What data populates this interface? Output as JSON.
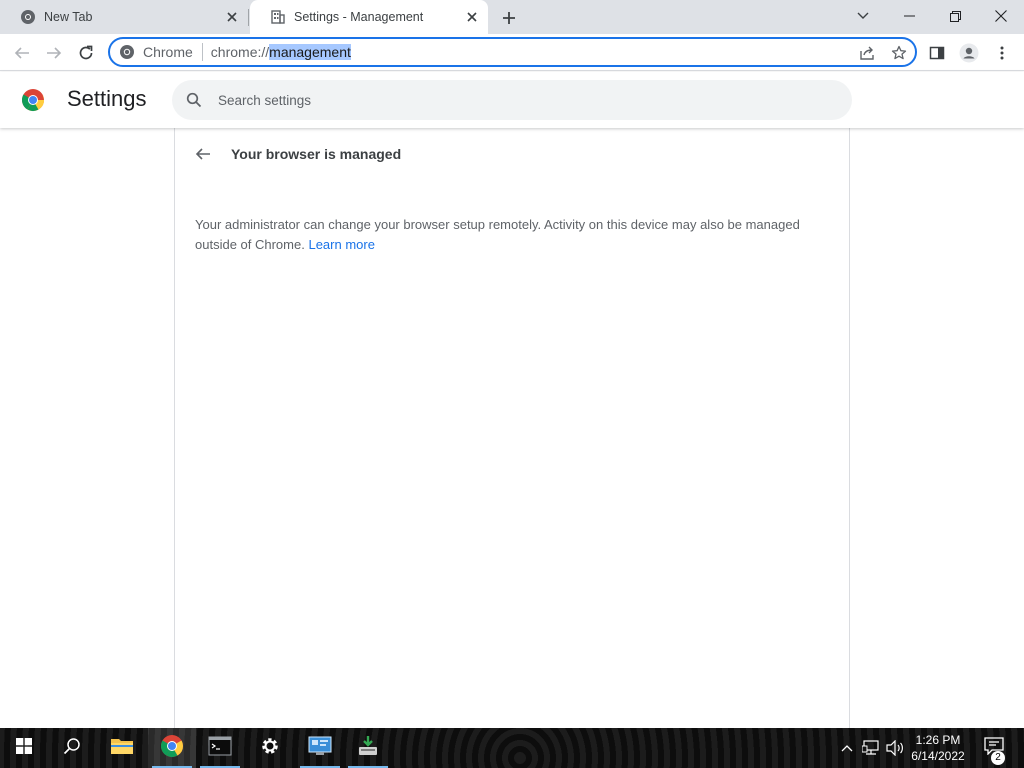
{
  "tabs": [
    {
      "title": "New Tab",
      "icon": "chrome-icon",
      "active": false
    },
    {
      "title": "Settings - Management",
      "icon": "building-icon",
      "active": true
    }
  ],
  "omnibox": {
    "chip_label": "Chrome",
    "url_prefix": "chrome://",
    "url_selected": "management"
  },
  "settings": {
    "title": "Settings",
    "search_placeholder": "Search settings"
  },
  "management": {
    "heading": "Your browser is managed",
    "description": "Your administrator can change your browser setup remotely. Activity on this device may also be managed outside of Chrome.",
    "learn_more": "Learn more"
  },
  "taskbar": {
    "apps": [
      "file-explorer",
      "chrome",
      "terminal",
      "settings",
      "control-panel",
      "installer"
    ],
    "time": "1:26 PM",
    "date": "6/14/2022",
    "notification_count": "2"
  },
  "colors": {
    "accent": "#1a73e8",
    "tabstrip": "#dee1e6",
    "selection": "#a6c8ff"
  }
}
